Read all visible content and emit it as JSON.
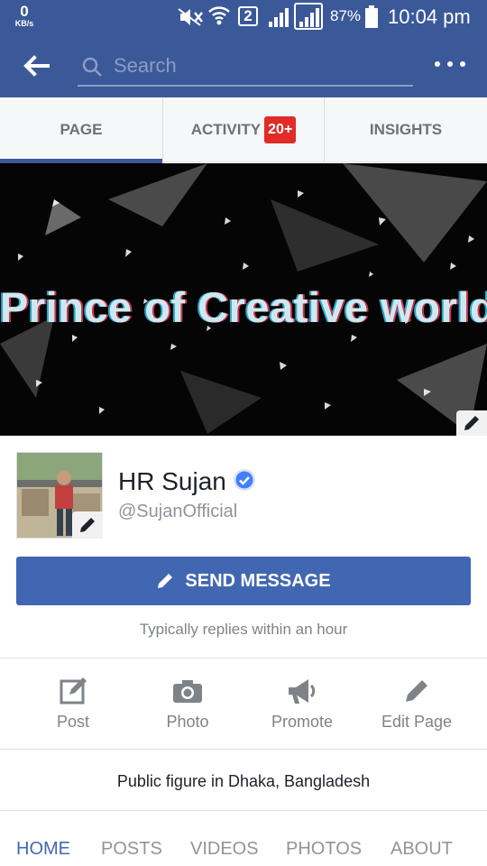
{
  "status_bar": {
    "speed_value": "0",
    "speed_unit": "KB/s",
    "sim_label": "2",
    "battery": "87%",
    "time": "10:04 pm"
  },
  "top_nav": {
    "search_placeholder": "Search"
  },
  "tabs": [
    {
      "label": "PAGE",
      "active": true
    },
    {
      "label": "ACTIVITY",
      "badge": "20+"
    },
    {
      "label": "INSIGHTS"
    }
  ],
  "cover": {
    "title": "Prince of Creative world"
  },
  "profile": {
    "name": "HR Sujan",
    "username": "@SujanOfficial",
    "verified": true
  },
  "send_message": {
    "label": "SEND MESSAGE",
    "reply_note": "Typically replies within an hour"
  },
  "actions": [
    {
      "label": "Post",
      "icon": "edit-square-icon"
    },
    {
      "label": "Photo",
      "icon": "camera-icon"
    },
    {
      "label": "Promote",
      "icon": "megaphone-icon"
    },
    {
      "label": "Edit Page",
      "icon": "pencil-icon"
    }
  ],
  "category": "Public figure in Dhaka, Bangladesh",
  "bottom_tabs": [
    {
      "label": "HOME",
      "active": true
    },
    {
      "label": "POSTS"
    },
    {
      "label": "VIDEOS"
    },
    {
      "label": "PHOTOS"
    },
    {
      "label": "ABOUT"
    }
  ],
  "colors": {
    "brand": "#3b5998",
    "button": "#4267b2",
    "badge": "#e02b27",
    "verified": "#4080ff"
  }
}
